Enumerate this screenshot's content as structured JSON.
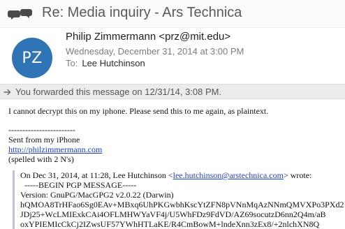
{
  "header": {
    "subject": "Re: Media inquiry - Ars Technica",
    "avatar_initials": "PZ",
    "avatar_color": "#2f74b5",
    "from": "Philip Zimmermann <prz@mit.edu>",
    "date": "Wednesday, December 31, 2014 at 3:00 PM",
    "to_label": "To:",
    "to_name": "Lee Hutchinson"
  },
  "forward_notice": "You forwarded this message on 12/31/14, 3:08 PM.",
  "body": {
    "line1": "I cannot decrypt this on my iphone. Please send this to me again, as plaintext.",
    "separator": "------------------------",
    "sent_from": "Sent from my iPhone",
    "link": "http://philzimmermann.com",
    "spelled": "(spelled with 2 N's)"
  },
  "quote": {
    "intro_prefix": "On Dec 31, 2014, at 11:28, Lee Hutchinson <",
    "intro_email": "lee.hutchinson@arstechnica.com",
    "intro_suffix": "> wrote:",
    "begin": "-----BEGIN PGP MESSAGE-----",
    "version": "Version: GnuPG/MacGPG2 v2.0.22 (Darwin)",
    "lines": [
      "hQMOA8TrHFao6Sg0EAv+MBxq6UhPKGwbhKscYtZFN8pVNnMqAzNNmQMVXPo3PXd2",
      "JDj25+WcLMIExkCAi4OFLMHWYaVF4j/U5WhFDz9FdVD/AZ69socutzD6nn2Q4m/aB",
      "oxYPIEMIcCkCj2IZwsUF57YWhHTLaKE/R4CmBowM+lndeXnn3zEx8/+2nlchXN8Q"
    ]
  }
}
